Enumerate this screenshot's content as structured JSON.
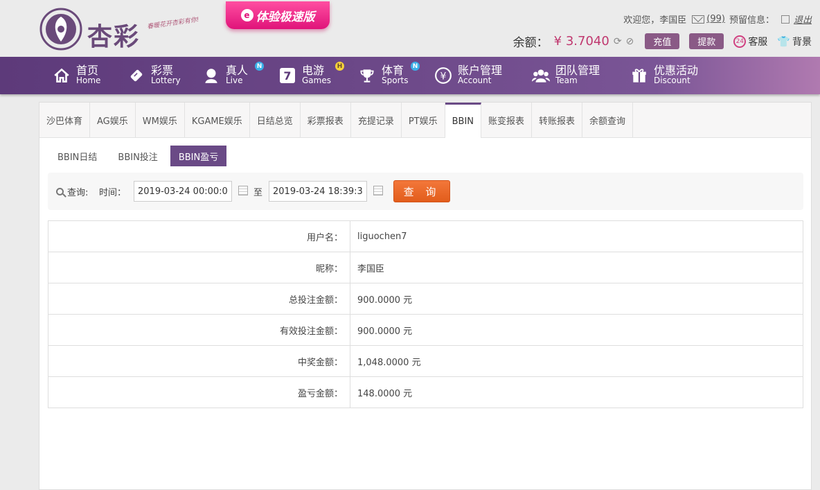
{
  "brand": {
    "name": "杏彩",
    "slogan": "春暖花开杏彩有你!"
  },
  "promo": {
    "label": "体验极速版"
  },
  "user": {
    "welcome": "欢迎您，",
    "username": "李国臣",
    "messages": "(99)",
    "reserved_info": "预留信息：",
    "logout": "退出"
  },
  "balance": {
    "label": "余额：",
    "value": "¥ 3.7040",
    "deposit": "充值",
    "withdraw": "提款",
    "service": "客服",
    "background": "背景"
  },
  "nav": [
    {
      "cn": "首页",
      "en": "Home",
      "icon": "home-icon"
    },
    {
      "cn": "彩票",
      "en": "Lottery",
      "icon": "ticket-icon"
    },
    {
      "cn": "真人",
      "en": "Live",
      "icon": "dealer-icon",
      "badge": "N"
    },
    {
      "cn": "电游",
      "en": "Games",
      "icon": "seven-icon",
      "badge": "H"
    },
    {
      "cn": "体育",
      "en": "Sports",
      "icon": "trophy-icon",
      "badge": "N"
    },
    {
      "cn": "账户管理",
      "en": "Account",
      "icon": "yen-icon"
    },
    {
      "cn": "团队管理",
      "en": "Team",
      "icon": "team-icon"
    },
    {
      "cn": "优惠活动",
      "en": "Discount",
      "icon": "gift-icon"
    }
  ],
  "tabs": [
    "沙巴体育",
    "AG娱乐",
    "WM娱乐",
    "KGAME娱乐",
    "日结总览",
    "彩票报表",
    "充提记录",
    "PT娱乐",
    "BBIN",
    "账变报表",
    "转账报表",
    "余额查询"
  ],
  "active_tab": "BBIN",
  "subtabs": [
    "BBIN日结",
    "BBIN投注",
    "BBIN盈亏"
  ],
  "active_subtab": "BBIN盈亏",
  "query": {
    "search_label": "查询:",
    "time_label": "时间：",
    "start": "2019-03-24 00:00:00",
    "to": "至",
    "end": "2019-03-24 18:39:31",
    "button": "查 询"
  },
  "result": [
    {
      "label": "用户名：",
      "value": "liguochen7"
    },
    {
      "label": "昵称：",
      "value": "李国臣"
    },
    {
      "label": "总投注金额：",
      "value": "900.0000 元"
    },
    {
      "label": "有效投注金额：",
      "value": "900.0000 元"
    },
    {
      "label": "中奖金额：",
      "value": "1,048.0000 元"
    },
    {
      "label": "盈亏金额：",
      "value": "148.0000 元"
    }
  ],
  "colors": {
    "nav": "#6c4888",
    "accent": "#c0386f",
    "query_button": "#e8632a",
    "active_subtab": "#6a4a86"
  }
}
